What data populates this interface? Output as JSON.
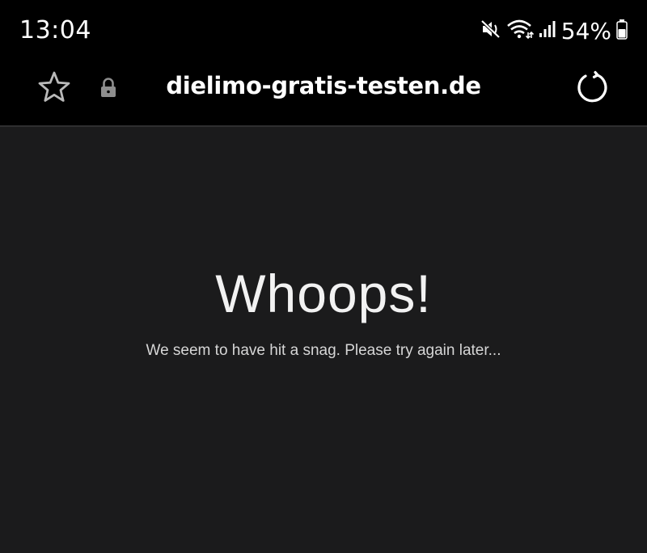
{
  "status_bar": {
    "time": "13:04",
    "battery_percent": "54%",
    "icons": [
      "mute-icon",
      "wifi-icon",
      "signal-icon",
      "battery-icon"
    ]
  },
  "address_bar": {
    "url": "dielimo-gratis-testen.de",
    "icons": [
      "star-icon",
      "lock-icon",
      "reload-icon"
    ]
  },
  "page": {
    "title": "Whoops!",
    "message": "We seem to have hit a snag. Please try again later..."
  },
  "colors": {
    "bar_background": "#000000",
    "page_background": "#1b1b1c",
    "text": "#ffffff"
  }
}
